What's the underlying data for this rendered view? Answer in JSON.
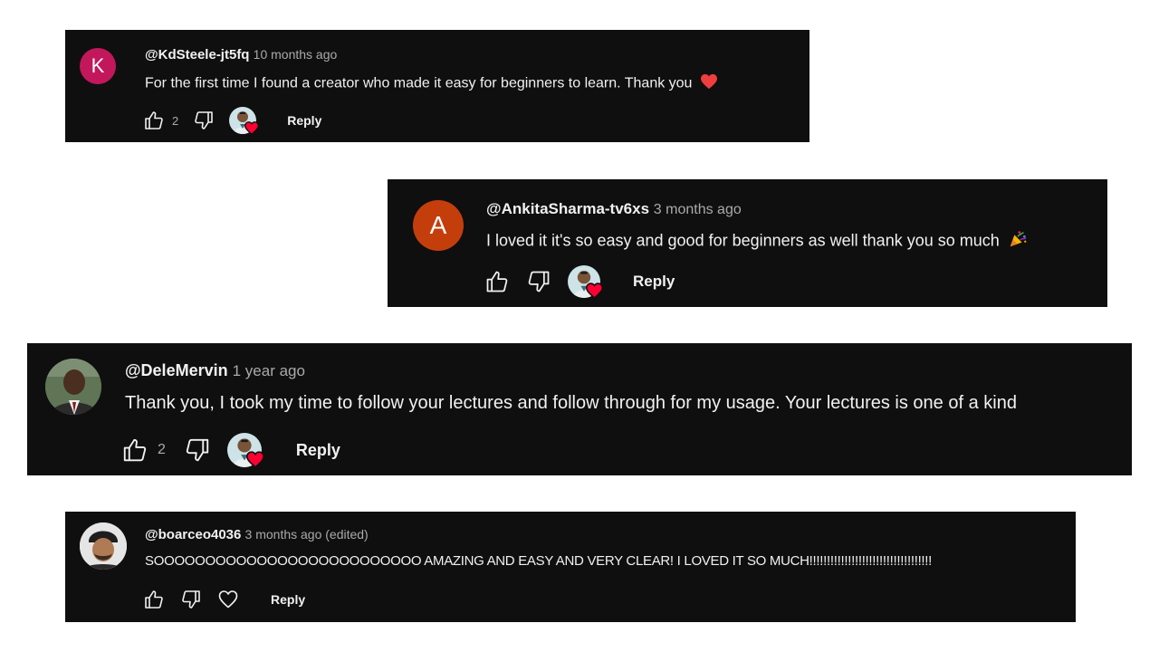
{
  "comments": [
    {
      "avatar_letter": "K",
      "avatar_color": "#c2185b",
      "handle": "@KdSteele-jt5fq",
      "time": "10 months ago",
      "text": "For the first time I found a creator who made it easy for beginners to learn. Thank you",
      "emoji": "heart",
      "like_count": "2",
      "reply_label": "Reply"
    },
    {
      "avatar_letter": "A",
      "avatar_color": "#c43e0c",
      "handle": "@AnkitaSharma-tv6xs",
      "time": "3 months ago",
      "text": "I loved it it's so easy and good for beginners as well thank you so much",
      "emoji": "party-popper",
      "like_count": "",
      "reply_label": "Reply"
    },
    {
      "avatar_photo": "man-in-suit",
      "handle": "@DeleMervin",
      "time": "1 year ago",
      "text": "Thank you, I took my time to follow your lectures and follow through for my usage. Your lectures is one of a kind",
      "like_count": "2",
      "reply_label": "Reply"
    },
    {
      "avatar_photo": "man-with-cap",
      "handle": "@boarceo4036",
      "time": "3 months ago (edited)",
      "text": "SOOOOOOOOOOOOOOOOOOOOOOOOOO AMAZING AND EASY AND VERY CLEAR! I LOVED IT SO MUCH!!!!!!!!!!!!!!!!!!!!!!!!!!!!!!!!!!!",
      "like_count": "",
      "reply_label": "Reply"
    }
  ],
  "icons": {
    "like": "thumb-up-icon",
    "dislike": "thumb-down-icon",
    "creator_heart": "creator-heart-icon",
    "heart_outline": "heart-outline-icon"
  },
  "colors": {
    "card_bg": "#0f0f0f",
    "text": "#f1f1f1",
    "secondary": "#aaaaaa",
    "heart": "#ff0033"
  }
}
